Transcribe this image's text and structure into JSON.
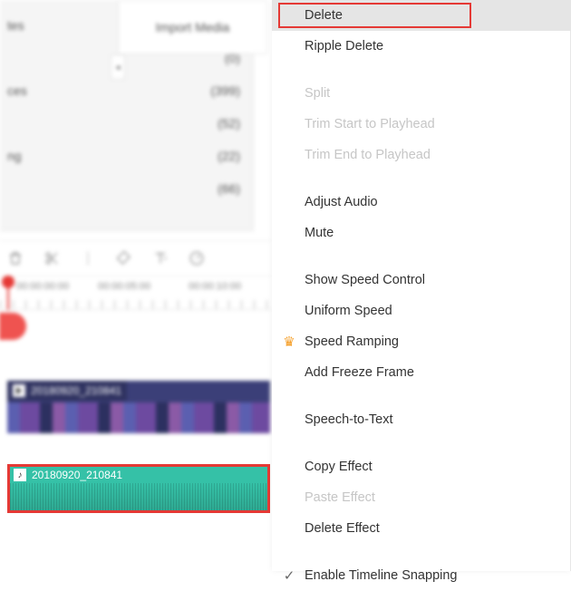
{
  "sidebar": {
    "items": [
      {
        "label": "tes",
        "count": ""
      },
      {
        "label": "",
        "count": "(0)"
      },
      {
        "label": "ces",
        "count": "(399)"
      },
      {
        "label": "",
        "count": "(52)"
      },
      {
        "label": "ng",
        "count": "(22)"
      },
      {
        "label": "",
        "count": "(66)"
      }
    ]
  },
  "import_label": "Import Media",
  "ruler": {
    "t1": "00:00:00:00",
    "t2": "00:00:05:00",
    "t3": "00:00:10:00"
  },
  "video_clip": {
    "name": "20180920_210841"
  },
  "audio_clip": {
    "name": "20180920_210841"
  },
  "context_menu": {
    "delete": "Delete",
    "ripple_delete": "Ripple Delete",
    "split": "Split",
    "trim_start": "Trim Start to Playhead",
    "trim_end": "Trim End to Playhead",
    "adjust_audio": "Adjust Audio",
    "mute": "Mute",
    "show_speed": "Show Speed Control",
    "uniform_speed": "Uniform Speed",
    "speed_ramping": "Speed Ramping",
    "freeze_frame": "Add Freeze Frame",
    "stt": "Speech-to-Text",
    "copy_effect": "Copy Effect",
    "paste_effect": "Paste Effect",
    "delete_effect": "Delete Effect",
    "snapping": "Enable Timeline Snapping"
  }
}
